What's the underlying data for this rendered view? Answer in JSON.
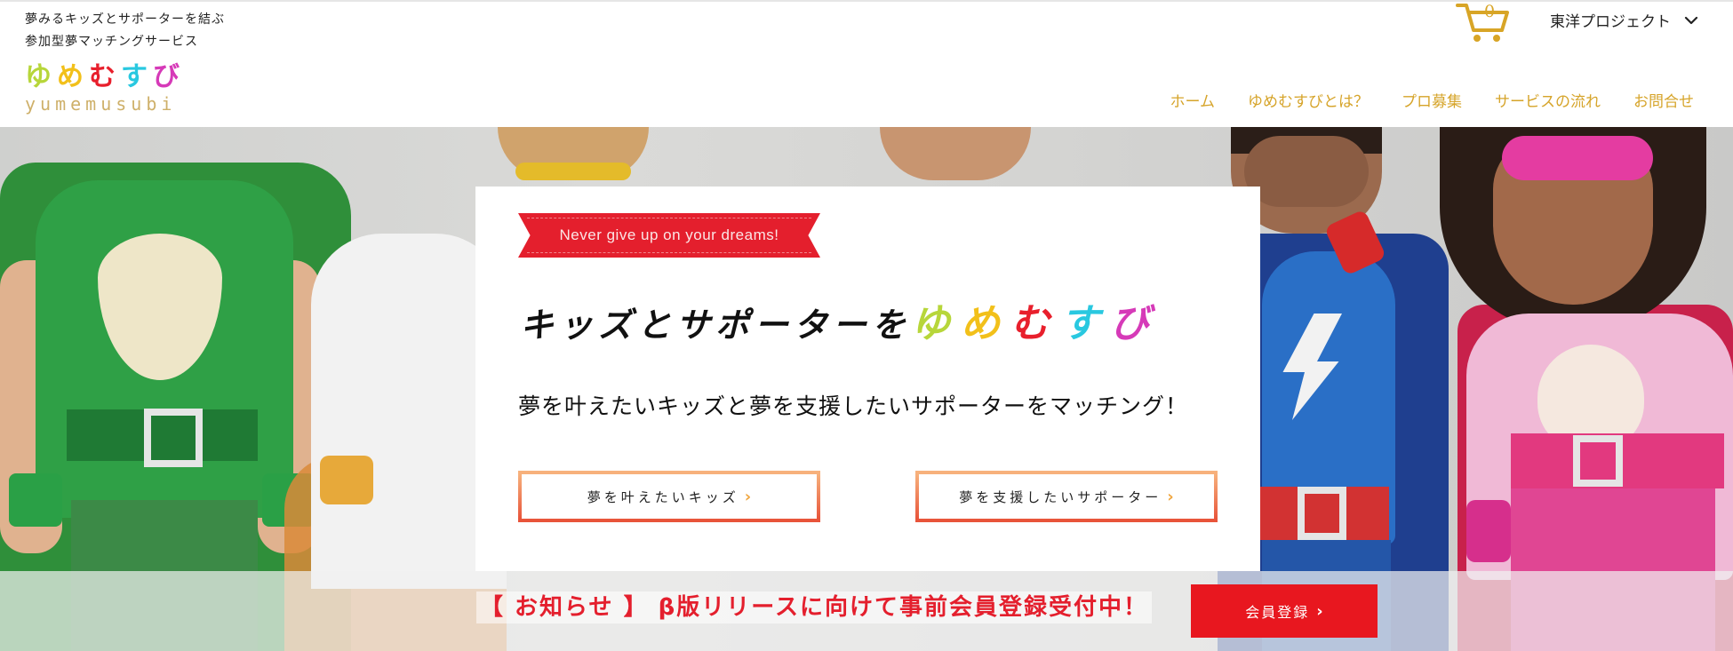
{
  "header": {
    "tagline_line1": "夢みるキッズとサポーターを結ぶ",
    "tagline_line2": "参加型夢マッチングサービス",
    "logo_kana": [
      "ゆ",
      "め",
      "む",
      "す",
      "び"
    ],
    "logo_kana_colors": [
      "#b7d63a",
      "#f2c01a",
      "#e81f2c",
      "#29c8e0",
      "#d63ab8"
    ],
    "logo_roman": "yumemusubi",
    "cart_count": "0",
    "account_name": "東洋プロジェクト",
    "nav": [
      "ホーム",
      "ゆめむすびとは？",
      "プロ募集",
      "サービスの流れ",
      "お問合せ"
    ]
  },
  "hero": {
    "ribbon_text": "Never give up on your dreams!",
    "headline_dark": "キッズとサポーターを",
    "headline_kana": [
      "ゆ",
      "め",
      "む",
      "す",
      "び"
    ],
    "subcopy": "夢を叶えたいキッズと夢を支援したいサポーターをマッチング！",
    "cta_kids": "夢を叶えたいキッズ",
    "cta_supporters": "夢を支援したいサポーター"
  },
  "notice": {
    "text": "【 お知らせ 】 β版リリースに向けて事前会員登録受付中！",
    "register_label": "会員登録"
  },
  "colors": {
    "accent_gold": "#d6a42a",
    "brand_red": "#e41f2d",
    "cta_orange": "#f08640"
  },
  "icons": {
    "cart": "shopping-cart-icon",
    "account_dropdown": "chevron-down-icon",
    "cta_arrow": "chevron-right-icon"
  }
}
